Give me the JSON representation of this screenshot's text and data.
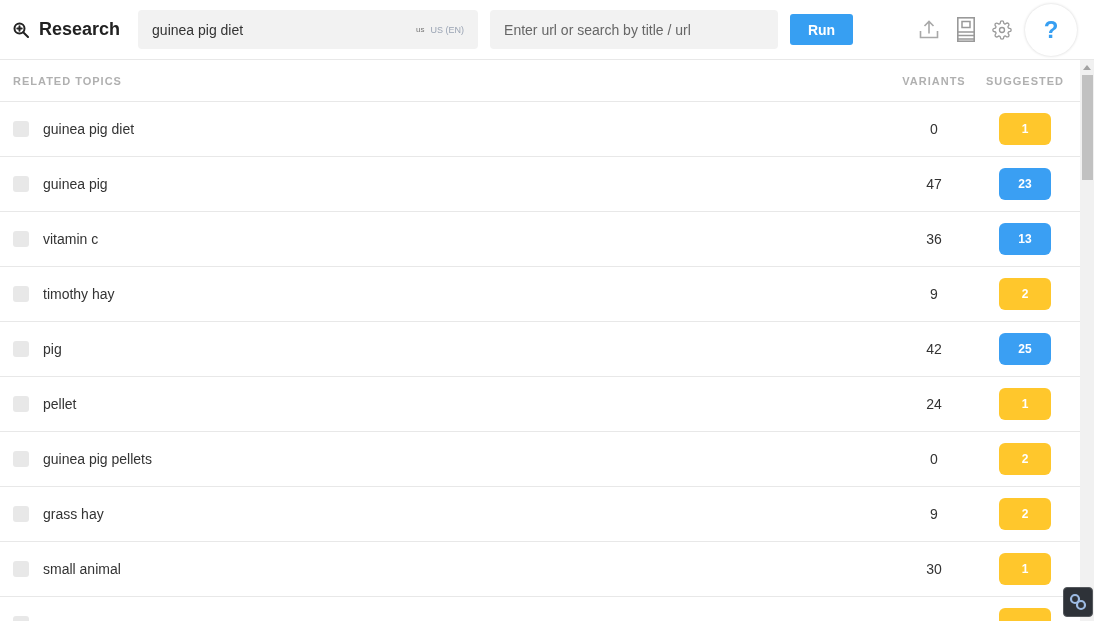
{
  "header": {
    "title": "Research",
    "search": {
      "value": "guinea pig diet",
      "region_code": "us",
      "region": "US (EN)"
    },
    "url_field": {
      "placeholder": "Enter url or search by title / url"
    },
    "run_button": "Run",
    "help_button": "?"
  },
  "table": {
    "columns": [
      "RELATED TOPICS",
      "VARIANTS",
      "SUGGESTED"
    ],
    "rows": [
      {
        "topic": "guinea pig diet",
        "checked": false,
        "variants": "0",
        "suggested": "1",
        "color": "#ffc72c"
      },
      {
        "topic": "guinea pig",
        "checked": false,
        "variants": "47",
        "suggested": "23",
        "color": "#3a9ff3"
      },
      {
        "topic": "vitamin c",
        "checked": false,
        "variants": "36",
        "suggested": "13",
        "color": "#3a9ff3"
      },
      {
        "topic": "timothy hay",
        "checked": false,
        "variants": "9",
        "suggested": "2",
        "color": "#ffc72c"
      },
      {
        "topic": "pig",
        "checked": false,
        "variants": "42",
        "suggested": "25",
        "color": "#3a9ff3"
      },
      {
        "topic": "pellet",
        "checked": false,
        "variants": "24",
        "suggested": "1",
        "color": "#ffc72c"
      },
      {
        "topic": "guinea pig pellets",
        "checked": false,
        "variants": "0",
        "suggested": "2",
        "color": "#ffc72c"
      },
      {
        "topic": "grass hay",
        "checked": false,
        "variants": "9",
        "suggested": "2",
        "color": "#ffc72c"
      },
      {
        "topic": "small animal",
        "checked": false,
        "variants": "30",
        "suggested": "1",
        "color": "#ffc72c"
      },
      {
        "checked": false,
        "color": "#ffc72c"
      }
    ]
  }
}
